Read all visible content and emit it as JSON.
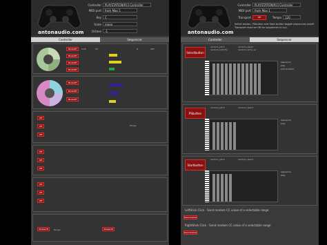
{
  "left": {
    "logo": "antonaudio.com",
    "fields": {
      "controller_label": "Controller",
      "controller_value": "PLAYSTATION(R)3 Controller",
      "midi_label": "MIDI port",
      "midi_value": "from Max 1",
      "key_label": "Key",
      "key_value": "C",
      "scale_label": "Scale",
      "scale_value": "major",
      "octave_label": "Octave",
      "octave_value": "-1"
    },
    "tabs": [
      "Controller",
      "Sequencer"
    ],
    "mode_labels": [
      "ModeOff",
      "ModeOff",
      "ModeOff",
      "ModeOff",
      "ModeOff"
    ],
    "cc_label": "CC#",
    "ch_label": "CH",
    "range_label": "Range",
    "val_1": "0",
    "val_127": "127",
    "off_label": "Off",
    "shake_labels": [
      "ShakeOff",
      "ShakeOff"
    ],
    "colors": {
      "accent_red": "#8a1111",
      "yellow": "#e2d11a",
      "purple": "#3a1ea0",
      "green": "#24a73a"
    }
  },
  "right": {
    "logo": "antonaudio.com",
    "fields": {
      "controller_label": "Controller",
      "controller_value": "PLAYSTATION(R)3 Controller",
      "midi_label": "MIDI port",
      "midi_value": "from Max 1",
      "transport_label": "Transport",
      "transport_value": "Off",
      "tempo_label": "Tempo",
      "tempo_value": "120"
    },
    "help_text": "Select button, PSbutton and Start button toggle sequences on/off. Transport must be ON for sequences to run.",
    "tabs": [
      "Controller",
      "Sequencer"
    ],
    "seq_buttons": [
      "Selectbutton",
      "PSbutton",
      "Startbutton"
    ],
    "random_labels": [
      "random_pitch",
      "random_velocity",
      "random_select",
      "random_ramp_up",
      "random_ramp_down",
      "random_in"
    ],
    "side_labels": [
      "sequence",
      "play",
      "sort duration"
    ],
    "footer_left": "LeftStick Click - Send random CC value of a selectable range",
    "footer_right": "RightStick Click - Send random CC value of a selectable range",
    "deactivated": "Deactivated"
  }
}
